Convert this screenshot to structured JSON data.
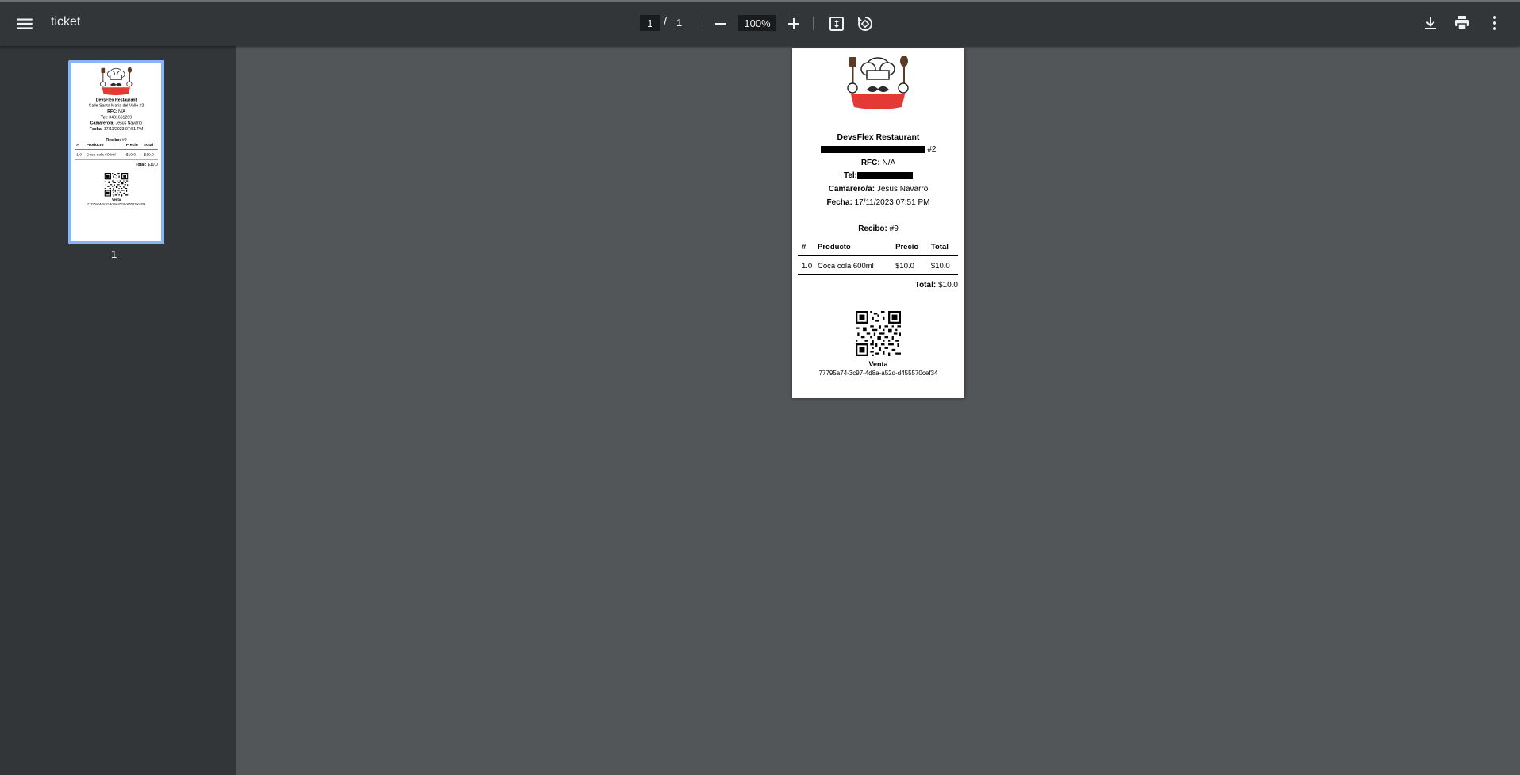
{
  "toolbar": {
    "title": "ticket",
    "page_current": "1",
    "page_separator": "/",
    "page_total": "1",
    "zoom": "100%",
    "icons": [
      "menu-icon",
      "zoom-out-icon",
      "zoom-in-icon",
      "fit-page-icon",
      "rotate-icon",
      "download-icon",
      "print-icon",
      "more-vert-icon"
    ]
  },
  "sidebar": {
    "thumbnails": [
      {
        "label": "1"
      }
    ]
  },
  "receipt": {
    "restaurant_name": "DevsFlex Restaurant",
    "address_suffix": "#2",
    "rfc_label": "RFC:",
    "rfc_value": "N/A",
    "tel_label": "Tel:",
    "waiter_label": "Camarero/a:",
    "waiter_value": "Jesus Navarro",
    "date_label": "Fecha:",
    "date_value": "17/11/2023 07:51 PM",
    "receipt_label": "Recibo:",
    "receipt_value": "#9",
    "table_headers": [
      "#",
      "Producto",
      "Precio",
      "Total"
    ],
    "items": [
      {
        "qty": "1.0",
        "product": "Coca cola 600ml",
        "price": "$10.0",
        "total": "$10.0"
      }
    ],
    "total_label": "Total:",
    "total_value": "$10.0",
    "sale_label": "Venta",
    "sale_id": "77795a74-3c97-4d8a-a52d-d455570cef34"
  },
  "thumbnail_receipt": {
    "address": "Calle Santa Maria del Valle #2",
    "tel_value": "3481661209",
    "date_value": "17/11/2023 07:51 PM",
    "receipt_value": "#9"
  },
  "colors": {
    "toolbar_bg": "#323639",
    "viewer_bg": "#525659",
    "thumb_highlight": "#8ab4f8",
    "chef_band": "#e53935"
  }
}
